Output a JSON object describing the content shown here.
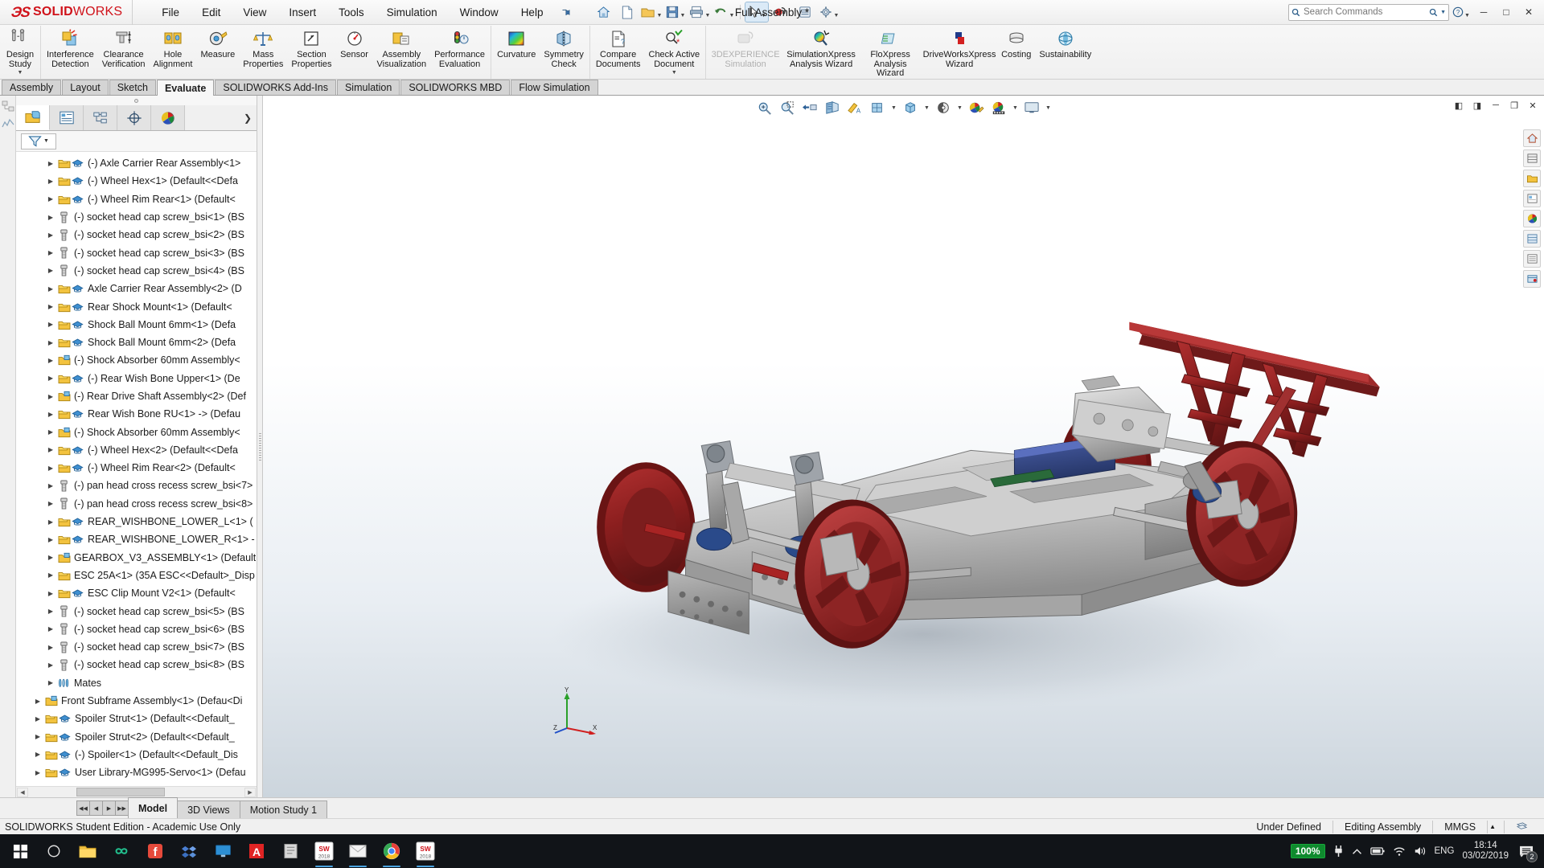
{
  "app": {
    "brand_sol": "SOLID",
    "brand_works": "WORKS",
    "document_title": "Full Assembly *"
  },
  "menu": {
    "items": [
      {
        "label": "File"
      },
      {
        "label": "Edit"
      },
      {
        "label": "View"
      },
      {
        "label": "Insert"
      },
      {
        "label": "Tools"
      },
      {
        "label": "Simulation"
      },
      {
        "label": "Window"
      },
      {
        "label": "Help"
      }
    ],
    "pin_icon": "pushpin-icon"
  },
  "quick_access": {
    "items": [
      {
        "name": "home-icon"
      },
      {
        "name": "new-document-icon"
      },
      {
        "name": "open-document-icon"
      },
      {
        "name": "save-icon"
      },
      {
        "name": "print-icon"
      },
      {
        "name": "undo-icon"
      },
      {
        "name": "select-icon"
      },
      {
        "name": "rebuild-icon"
      },
      {
        "name": "options-icon"
      },
      {
        "name": "settings-gear-icon"
      }
    ]
  },
  "search": {
    "placeholder": "Search Commands",
    "magnifier_icon": "search-icon",
    "dropdown_icon": "chevron-down-icon"
  },
  "window_controls": {
    "help_icon": "question-icon",
    "minimize": "─",
    "maximize": "□",
    "close": "✕"
  },
  "ribbon": {
    "groups": [
      {
        "commands": [
          {
            "label": "Design\nStudy",
            "label_l1": "Design",
            "label_l2": "Study",
            "icon": "design-study-icon",
            "disabled": false,
            "has_dropdown": true
          }
        ]
      },
      {
        "commands": [
          {
            "label_l1": "Interference",
            "label_l2": "Detection",
            "icon": "interference-detection-icon",
            "disabled": false
          },
          {
            "label_l1": "Clearance",
            "label_l2": "Verification",
            "icon": "clearance-verification-icon",
            "disabled": false
          },
          {
            "label_l1": "Hole",
            "label_l2": "Alignment",
            "icon": "hole-alignment-icon",
            "disabled": false
          },
          {
            "label_l1": "Measure",
            "label_l2": "",
            "icon": "measure-icon",
            "disabled": false
          },
          {
            "label_l1": "Mass",
            "label_l2": "Properties",
            "icon": "mass-properties-icon",
            "disabled": false
          },
          {
            "label_l1": "Section",
            "label_l2": "Properties",
            "icon": "section-properties-icon",
            "disabled": false
          },
          {
            "label_l1": "Sensor",
            "label_l2": "",
            "icon": "sensor-icon",
            "disabled": false
          },
          {
            "label_l1": "Assembly",
            "label_l2": "Visualization",
            "icon": "assembly-visualization-icon",
            "disabled": false
          },
          {
            "label_l1": "Performance",
            "label_l2": "Evaluation",
            "icon": "performance-evaluation-icon",
            "disabled": false
          }
        ]
      },
      {
        "commands": [
          {
            "label_l1": "Curvature",
            "label_l2": "",
            "icon": "curvature-icon",
            "disabled": false
          },
          {
            "label_l1": "Symmetry",
            "label_l2": "Check",
            "icon": "symmetry-check-icon",
            "disabled": false
          }
        ]
      },
      {
        "commands": [
          {
            "label_l1": "Compare",
            "label_l2": "Documents",
            "icon": "compare-documents-icon",
            "disabled": false
          },
          {
            "label_l1": "Check Active",
            "label_l2": "Document",
            "icon": "check-active-document-icon",
            "disabled": false,
            "has_dropdown": true
          }
        ]
      },
      {
        "commands": [
          {
            "label_l1": "3DEXPERIENCE",
            "label_l2": "Simulation",
            "icon": "3dexperience-simulation-icon",
            "disabled": true
          },
          {
            "label_l1": "SimulationXpress",
            "label_l2": "Analysis Wizard",
            "icon": "simulationxpress-icon",
            "disabled": false
          },
          {
            "label_l1": "FloXpress",
            "label_l2": "Analysis Wizard",
            "icon": "floxpress-icon",
            "disabled": false
          },
          {
            "label_l1": "DriveWorksXpress",
            "label_l2": "Wizard",
            "icon": "driveworksxpress-icon",
            "disabled": false
          },
          {
            "label_l1": "Costing",
            "label_l2": "",
            "icon": "costing-icon",
            "disabled": false
          },
          {
            "label_l1": "Sustainability",
            "label_l2": "",
            "icon": "sustainability-icon",
            "disabled": false
          }
        ]
      }
    ]
  },
  "command_tabs": [
    {
      "label": "Assembly",
      "active": false
    },
    {
      "label": "Layout",
      "active": false
    },
    {
      "label": "Sketch",
      "active": false
    },
    {
      "label": "Evaluate",
      "active": true
    },
    {
      "label": "SOLIDWORKS Add-Ins",
      "active": false
    },
    {
      "label": "Simulation",
      "active": false
    },
    {
      "label": "SOLIDWORKS MBD",
      "active": false
    },
    {
      "label": "Flow Simulation",
      "active": false
    }
  ],
  "panel": {
    "tabs": [
      {
        "name": "feature-manager-design-tree-tab",
        "icon": "yellow-box-icon",
        "active": true
      },
      {
        "name": "property-manager-tab",
        "icon": "property-list-icon",
        "active": false
      },
      {
        "name": "configuration-manager-tab",
        "icon": "configuration-icon",
        "active": false
      },
      {
        "name": "dimxpert-manager-tab",
        "icon": "crosshair-icon",
        "active": false
      },
      {
        "name": "display-manager-tab",
        "icon": "color-sphere-icon",
        "active": false
      }
    ],
    "overflow_icon": "chevron-right-icon",
    "filter_icon": "filter-funnel-icon",
    "tree": [
      {
        "label": "(-) Axle Carrier Rear Assembly<1>",
        "icon": "component-icon",
        "badge": "mate-icon",
        "indent": 2
      },
      {
        "label": "(-) Wheel Hex<1>  (Default<<Defa",
        "icon": "component-icon",
        "badge": "mate-icon",
        "indent": 2
      },
      {
        "label": "(-) Wheel Rim Rear<1>  (Default<",
        "icon": "component-icon",
        "badge": "mate-icon",
        "indent": 2
      },
      {
        "label": "(-) socket head cap screw_bsi<1>  (BS",
        "icon": "screw-icon",
        "badge": null,
        "indent": 2
      },
      {
        "label": "(-) socket head cap screw_bsi<2>  (BS",
        "icon": "screw-icon",
        "badge": null,
        "indent": 2
      },
      {
        "label": "(-) socket head cap screw_bsi<3>  (BS",
        "icon": "screw-icon",
        "badge": null,
        "indent": 2
      },
      {
        "label": "(-) socket head cap screw_bsi<4>  (BS",
        "icon": "screw-icon",
        "badge": null,
        "indent": 2
      },
      {
        "label": "Axle Carrier Rear Assembly<2>  (D",
        "icon": "component-icon",
        "badge": "mate-icon",
        "indent": 2
      },
      {
        "label": "Rear Shock Mount<1>  (Default<",
        "icon": "component-icon",
        "badge": "mate-icon",
        "indent": 2
      },
      {
        "label": "Shock Ball Mount 6mm<1>  (Defa",
        "icon": "component-icon",
        "badge": "mate-icon",
        "indent": 2
      },
      {
        "label": "Shock Ball Mount 6mm<2>  (Defa",
        "icon": "component-icon",
        "badge": "mate-icon",
        "indent": 2
      },
      {
        "label": "(-) Shock Absorber 60mm Assembly<",
        "icon": "subassembly-icon",
        "badge": null,
        "indent": 2
      },
      {
        "label": "(-) Rear Wish Bone Upper<1>  (De",
        "icon": "component-icon",
        "badge": "mate-icon",
        "indent": 2
      },
      {
        "label": "(-) Rear Drive Shaft Assembly<2>  (Def",
        "icon": "subassembly-icon",
        "badge": null,
        "indent": 2
      },
      {
        "label": "Rear Wish Bone RU<1>  ->  (Defau",
        "icon": "component-icon",
        "badge": "mate-icon",
        "indent": 2
      },
      {
        "label": "(-) Shock Absorber 60mm Assembly<",
        "icon": "subassembly-icon",
        "badge": null,
        "indent": 2
      },
      {
        "label": "(-) Wheel Hex<2>  (Default<<Defa",
        "icon": "component-icon",
        "badge": "mate-icon",
        "indent": 2
      },
      {
        "label": "(-) Wheel Rim Rear<2>  (Default<",
        "icon": "component-icon",
        "badge": "mate-icon",
        "indent": 2
      },
      {
        "label": "(-) pan head cross recess screw_bsi<7>",
        "icon": "screw-icon",
        "badge": null,
        "indent": 2
      },
      {
        "label": "(-) pan head cross recess screw_bsi<8>",
        "icon": "screw-icon",
        "badge": null,
        "indent": 2
      },
      {
        "label": "REAR_WISHBONE_LOWER_L<1>  (",
        "icon": "component-icon",
        "badge": "mate-icon",
        "indent": 2
      },
      {
        "label": "REAR_WISHBONE_LOWER_R<1> -",
        "icon": "component-icon",
        "badge": "mate-icon",
        "indent": 2
      },
      {
        "label": "GEARBOX_V3_ASSEMBLY<1>  (Default",
        "icon": "subassembly-icon",
        "badge": null,
        "indent": 2
      },
      {
        "label": "ESC 25A<1>  (35A ESC<<Default>_Disp",
        "icon": "component-icon",
        "badge": null,
        "indent": 2
      },
      {
        "label": "ESC Clip Mount V2<1>  (Default<",
        "icon": "component-icon",
        "badge": "mate-icon",
        "indent": 2
      },
      {
        "label": "(-) socket head cap screw_bsi<5>  (BS",
        "icon": "screw-icon",
        "badge": null,
        "indent": 2
      },
      {
        "label": "(-) socket head cap screw_bsi<6>  (BS",
        "icon": "screw-icon",
        "badge": null,
        "indent": 2
      },
      {
        "label": "(-) socket head cap screw_bsi<7>  (BS",
        "icon": "screw-icon",
        "badge": null,
        "indent": 2
      },
      {
        "label": "(-) socket head cap screw_bsi<8>  (BS",
        "icon": "screw-icon",
        "badge": null,
        "indent": 2
      },
      {
        "label": "Mates",
        "icon": "mates-folder-icon",
        "badge": null,
        "indent": 2
      },
      {
        "label": "Front Subframe Assembly<1>  (Defau<Di",
        "icon": "subassembly-icon",
        "badge": null,
        "indent": 1
      },
      {
        "label": "Spoiler Strut<1>  (Default<<Default_",
        "icon": "component-icon",
        "badge": "mate-icon",
        "indent": 1
      },
      {
        "label": "Spoiler Strut<2>  (Default<<Default_",
        "icon": "component-icon",
        "badge": "mate-icon",
        "indent": 1
      },
      {
        "label": "(-) Spoiler<1>  (Default<<Default_Dis",
        "icon": "component-icon",
        "badge": "mate-icon",
        "indent": 1
      },
      {
        "label": "User Library-MG995-Servo<1>  (Defau",
        "icon": "component-icon",
        "badge": "mate-icon",
        "indent": 1
      }
    ]
  },
  "viewport_toolbar": {
    "items": [
      {
        "name": "zoom-to-fit-icon",
        "dropdown": false
      },
      {
        "name": "zoom-to-area-icon",
        "dropdown": false
      },
      {
        "name": "previous-view-icon",
        "dropdown": false
      },
      {
        "name": "section-view-icon",
        "dropdown": false
      },
      {
        "name": "view-orientation-paint-icon",
        "dropdown": false
      },
      {
        "name": "view-orientation-icon",
        "dropdown": true
      },
      {
        "name": "display-style-icon",
        "dropdown": true
      },
      {
        "name": "hide-show-items-icon",
        "dropdown": true
      },
      {
        "name": "edit-appearance-icon",
        "dropdown": false
      },
      {
        "name": "apply-scene-icon",
        "dropdown": true
      },
      {
        "name": "view-settings-icon",
        "dropdown": true
      }
    ],
    "window_buttons": [
      {
        "name": "restore-pane-left-icon",
        "glyph": "◧"
      },
      {
        "name": "restore-pane-right-icon",
        "glyph": "◨"
      },
      {
        "name": "minimize-doc-icon",
        "glyph": "─"
      },
      {
        "name": "restore-doc-icon",
        "glyph": "❐"
      },
      {
        "name": "close-doc-icon",
        "glyph": "✕"
      }
    ]
  },
  "view_right_rail": [
    {
      "name": "view-home-icon"
    },
    {
      "name": "appearance-library-icon"
    },
    {
      "name": "design-library-icon"
    },
    {
      "name": "file-explorer-icon"
    },
    {
      "name": "view-palette-icon"
    },
    {
      "name": "appearances-scenes-icon"
    },
    {
      "name": "custom-properties-icon"
    },
    {
      "name": "3dexperience-marketplace-icon"
    }
  ],
  "triad": {
    "y_label": "Y",
    "x_label": "X",
    "z_label": "Z"
  },
  "model_tabs": {
    "nav_buttons": [
      "◀◀",
      "◀",
      "▶",
      "▶▶"
    ],
    "tabs": [
      {
        "label": "Model",
        "active": true
      },
      {
        "label": "3D Views",
        "active": false
      },
      {
        "label": "Motion Study 1",
        "active": false
      }
    ]
  },
  "status_bar": {
    "left": "SOLIDWORKS Student Edition - Academic Use Only",
    "under_defined": "Under Defined",
    "editing": "Editing Assembly",
    "units": "MMGS",
    "units_caret": "▲",
    "tray_icon": "overlay-icon"
  },
  "taskbar": {
    "start_icon": "windows-start-icon",
    "apps": [
      {
        "name": "cortana-search-icon",
        "glyph": "○",
        "running": false,
        "color": "#ffffff"
      },
      {
        "name": "file-explorer-taskbar-icon",
        "glyph": "",
        "running": false,
        "color": "#f0c040"
      },
      {
        "name": "infinity-app-icon",
        "glyph": "∞",
        "running": false,
        "color": "#22c08e"
      },
      {
        "name": "facebook-icon",
        "glyph": "f",
        "running": false,
        "color": "#e64a3b"
      },
      {
        "name": "dropbox-icon",
        "glyph": "",
        "running": false,
        "color": "#4a7fd4"
      },
      {
        "name": "monitor-app-icon",
        "glyph": "",
        "running": false,
        "color": "#2d8fd4"
      },
      {
        "name": "autodesk-icon",
        "glyph": "A",
        "running": false,
        "color": "#e02424"
      },
      {
        "name": "notes-app-icon",
        "glyph": "",
        "running": false,
        "color": "#c9c9c9"
      },
      {
        "name": "solidworks-2018-icon",
        "glyph": "SW",
        "running": true,
        "color": "#d0121a",
        "sublabel": "2018"
      },
      {
        "name": "mail-app-icon",
        "glyph": "",
        "running": true,
        "color": "#e8e8e8"
      },
      {
        "name": "chrome-icon",
        "glyph": "",
        "running": true,
        "color": "#4285f4"
      },
      {
        "name": "solidworks-active-icon",
        "glyph": "SW",
        "running": true,
        "color": "#d0121a",
        "sublabel": "2018"
      }
    ],
    "tray": {
      "battery_percent": "100%",
      "show_hidden_icon": "chevron-up-icon",
      "plug_icon": "power-plug-icon",
      "battery_icon": "battery-icon",
      "wifi_icon": "wifi-icon",
      "volume_icon": "speaker-icon",
      "language": "ENG",
      "time": "18:14",
      "date": "03/02/2019",
      "notification_count": "2"
    }
  }
}
